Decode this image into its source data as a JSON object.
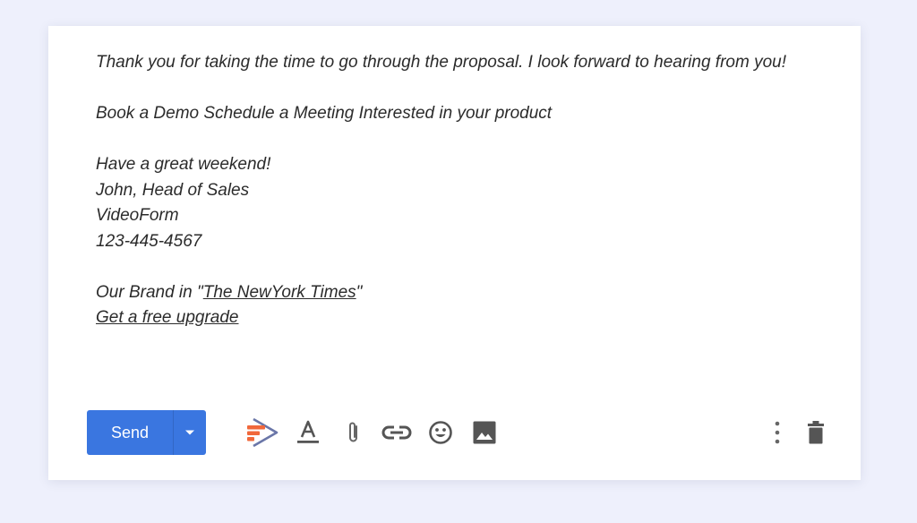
{
  "email": {
    "paragraph1": "Thank you for taking the time to go through the proposal. I look forward to hearing from you!",
    "cta_line": "Book a Demo Schedule a Meeting Interested in your product",
    "signature": {
      "greeting": "Have a great weekend!",
      "name_title": "John, Head of Sales",
      "company": "VideoForm",
      "phone": "123-445-4567"
    },
    "brand_prefix": "Our Brand in \"",
    "brand_link": "The NewYork Times",
    "brand_suffix": "\"",
    "upgrade_link": "Get a free upgrade"
  },
  "toolbar": {
    "send_label": "Send",
    "accent_color": "#3a76e0",
    "icons": [
      "videoform-icon",
      "text-format-icon",
      "attach-icon",
      "link-icon",
      "emoji-icon",
      "image-icon",
      "more-options-icon",
      "delete-icon"
    ]
  }
}
